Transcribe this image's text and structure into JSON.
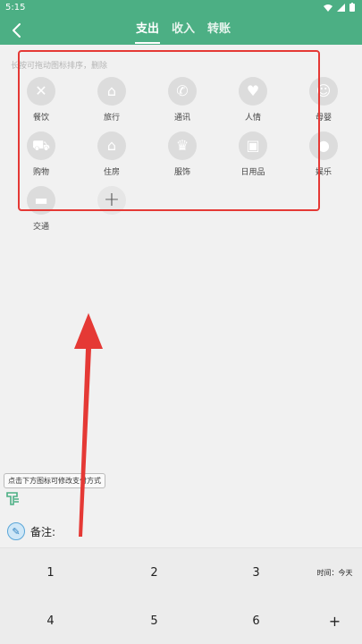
{
  "status_bar": {
    "time": "5:15"
  },
  "header": {
    "tabs": [
      {
        "label": "支出",
        "active": true
      },
      {
        "label": "收入",
        "active": false
      },
      {
        "label": "转账",
        "active": false
      }
    ]
  },
  "hint": "长按可拖动图标排序，删除",
  "categories": [
    {
      "label": "餐饮",
      "icon": "utensils-icon"
    },
    {
      "label": "旅行",
      "icon": "travel-icon"
    },
    {
      "label": "通讯",
      "icon": "phone-icon"
    },
    {
      "label": "人情",
      "icon": "gift-icon"
    },
    {
      "label": "母婴",
      "icon": "baby-icon"
    },
    {
      "label": "购物",
      "icon": "cart-icon"
    },
    {
      "label": "住房",
      "icon": "house-icon"
    },
    {
      "label": "服饰",
      "icon": "dress-icon"
    },
    {
      "label": "日用品",
      "icon": "daily-goods-icon"
    },
    {
      "label": "娱乐",
      "icon": "entertainment-icon"
    },
    {
      "label": "交通",
      "icon": "car-icon"
    }
  ],
  "add_category_symbol": "+",
  "payment_hint": "点击下方图标可修改支付方式",
  "note": {
    "label": "备注:"
  },
  "keypad": {
    "keys": [
      "1",
      "2",
      "3",
      "时间：今天",
      "4",
      "5",
      "6",
      "+"
    ]
  },
  "colors": {
    "header": "#4caf84",
    "annotation": "#e53935"
  }
}
